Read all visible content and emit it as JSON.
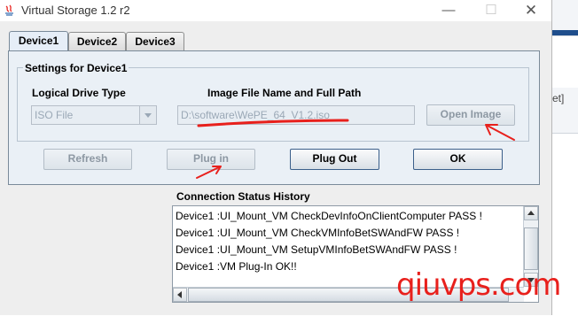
{
  "window": {
    "title": "Virtual Storage 1.2 r2"
  },
  "tabs": [
    {
      "label": "Device1",
      "active": true
    },
    {
      "label": "Device2",
      "active": false
    },
    {
      "label": "Device3",
      "active": false
    }
  ],
  "settings": {
    "group_title": "Settings for Device1",
    "drive_type_label": "Logical Drive Type",
    "drive_type_value": "ISO File",
    "image_label": "Image File Name and Full Path",
    "image_path": "D:\\software\\WePE_64_V1.2.iso",
    "open_image_label": "Open Image"
  },
  "buttons": {
    "refresh": "Refresh",
    "plug_in": "Plug in",
    "plug_out": "Plug Out",
    "ok": "OK"
  },
  "status": {
    "title": "Connection Status History",
    "lines": [
      "Device1 :UI_Mount_VM CheckDevInfoOnClientComputer PASS !",
      "Device1 :UI_Mount_VM CheckVMInfoBetSWAndFW PASS !",
      "Device1 :UI_Mount_VM SetupVMInfoBetSWAndFW PASS !",
      "Device1 :VM Plug-In OK!!"
    ]
  },
  "background": {
    "side_text": "et]"
  },
  "watermark": "qiuvps.com",
  "colors": {
    "annotation_red": "#e8201c",
    "tab_active": "#e6eef7",
    "panel": "#eaf0f6"
  }
}
